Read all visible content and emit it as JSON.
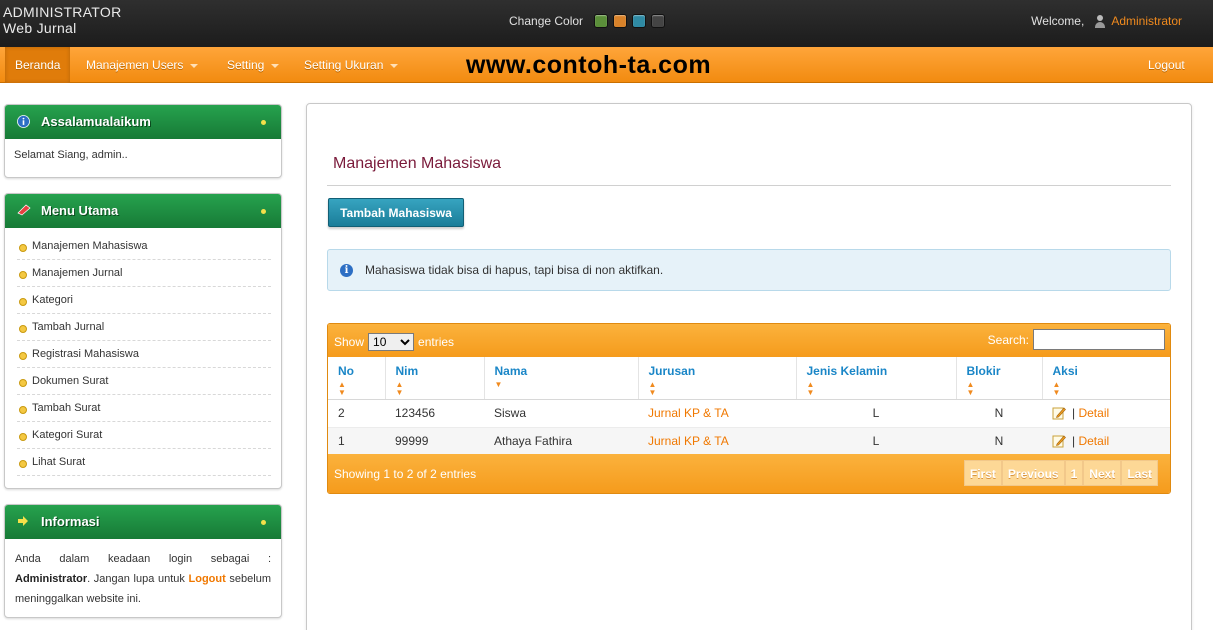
{
  "header": {
    "brand_line1": "ADMINISTRATOR",
    "brand_line2": "Web Jurnal",
    "change_color_label": "Change Color",
    "swatches": [
      "#5b8f3a",
      "#d8822a",
      "#2f8aa4",
      "#444444"
    ],
    "welcome_label": "Welcome,",
    "user_name": "Administrator"
  },
  "nav": {
    "items": [
      {
        "label": "Beranda"
      },
      {
        "label": "Manajemen Users"
      },
      {
        "label": "Setting"
      },
      {
        "label": "Setting Ukuran"
      }
    ],
    "watermark": "www.contoh-ta.com",
    "logout_label": "Logout"
  },
  "sidebar": {
    "greeting": {
      "title": "Assalamualaikum",
      "text": "Selamat Siang, admin.."
    },
    "menu": {
      "title": "Menu Utama",
      "items": [
        "Manajemen Mahasiswa",
        "Manajemen Jurnal",
        "Kategori",
        "Tambah Jurnal",
        "Registrasi Mahasiswa",
        "Dokumen Surat",
        "Tambah Surat",
        "Kategori Surat",
        "Lihat Surat"
      ]
    },
    "info": {
      "title": "Informasi",
      "text_1": "Anda dalam keadaan login sebagai :",
      "role": "Administrator",
      "text_2": ". Jangan lupa untuk",
      "logout_word": "Logout",
      "text_3": "sebelum meninggalkan website ini."
    }
  },
  "main": {
    "title": "Manajemen Mahasiswa",
    "add_button": "Tambah Mahasiswa",
    "notice": "Mahasiswa tidak bisa di hapus, tapi bisa di non aktifkan."
  },
  "table": {
    "show_label": "Show",
    "page_size": "10",
    "entries_label": "entries",
    "search_label": "Search:",
    "columns": [
      "No",
      "Nim",
      "Nama",
      "Jurusan",
      "Jenis Kelamin",
      "Blokir",
      "Aksi"
    ],
    "rows": [
      {
        "no": "2",
        "nim": "123456",
        "nama": "Siswa",
        "jurusan": "Jurnal KP & TA",
        "jk": "L",
        "blokir": "N",
        "aksi_sep": "|",
        "aksi_detail": "Detail"
      },
      {
        "no": "1",
        "nim": "99999",
        "nama": "Athaya Fathira",
        "jurusan": "Jurnal KP & TA",
        "jk": "L",
        "blokir": "N",
        "aksi_sep": "|",
        "aksi_detail": "Detail"
      }
    ],
    "info": "Showing 1 to 2 of 2 entries",
    "pager": {
      "first": "First",
      "previous": "Previous",
      "page": "1",
      "next": "Next",
      "last": "Last"
    }
  }
}
